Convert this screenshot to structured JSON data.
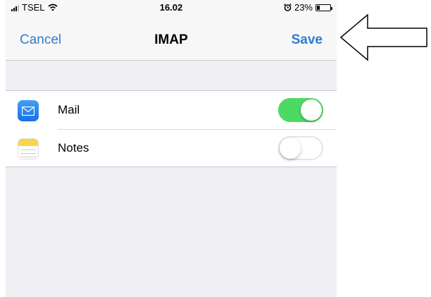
{
  "status_bar": {
    "carrier": "TSEL",
    "time": "16.02",
    "battery_percent": "23%",
    "battery_level": 0.23,
    "icons": [
      "signal-icon",
      "wifi-icon",
      "alarm-icon",
      "battery-icon"
    ]
  },
  "nav": {
    "cancel_label": "Cancel",
    "title": "IMAP",
    "save_label": "Save"
  },
  "rows": [
    {
      "label": "Mail",
      "icon": "mail-app-icon",
      "enabled": true
    },
    {
      "label": "Notes",
      "icon": "notes-app-icon",
      "enabled": false
    }
  ],
  "colors": {
    "accent": "#2f7bd1",
    "toggle_on": "#4cd964",
    "background": "#efeff4"
  },
  "annotation": {
    "icon": "left-arrow-icon"
  }
}
